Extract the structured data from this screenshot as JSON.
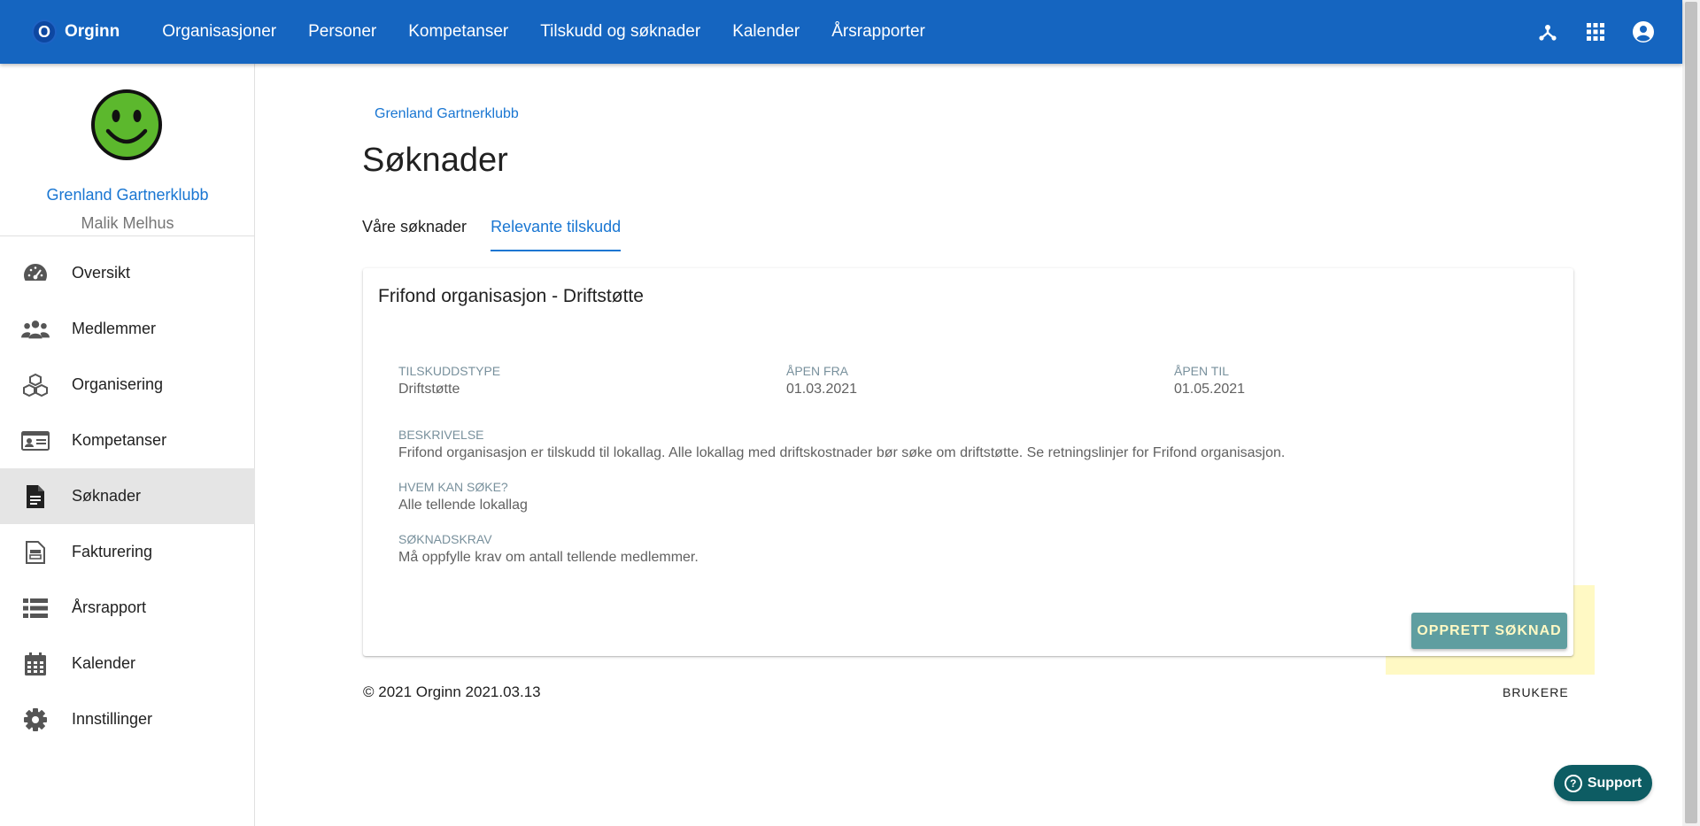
{
  "app": {
    "logo_letter": "O",
    "name": "Orginn"
  },
  "topnav": [
    {
      "label": "Organisasjoner"
    },
    {
      "label": "Personer"
    },
    {
      "label": "Kompetanser"
    },
    {
      "label": "Tilskudd og søknader"
    },
    {
      "label": "Kalender"
    },
    {
      "label": "Årsrapporter"
    }
  ],
  "top_icons": [
    "hub-icon",
    "apps-grid-icon",
    "account-circle-icon"
  ],
  "sidebar": {
    "avatar_icon": "smiley-face-icon",
    "org_name": "Grenland Gartnerklubb",
    "user_name": "Malik Melhus",
    "items": [
      {
        "label": "Oversikt",
        "icon": "speedometer-icon"
      },
      {
        "label": "Medlemmer",
        "icon": "people-icon"
      },
      {
        "label": "Organisering",
        "icon": "cubes-icon"
      },
      {
        "label": "Kompetanser",
        "icon": "id-card-icon"
      },
      {
        "label": "Søknader",
        "icon": "document-icon",
        "active": true
      },
      {
        "label": "Fakturering",
        "icon": "invoice-icon"
      },
      {
        "label": "Årsrapport",
        "icon": "list-icon"
      },
      {
        "label": "Kalender",
        "icon": "calendar-icon"
      },
      {
        "label": "Innstillinger",
        "icon": "gear-icon"
      }
    ]
  },
  "main": {
    "breadcrumb": "Grenland Gartnerklubb",
    "title": "Søknader",
    "tabs": [
      {
        "label": "Våre søknader"
      },
      {
        "label": "Relevante tilskudd",
        "active": true
      }
    ],
    "card": {
      "title": "Frifond organisasjon - Driftstøtte",
      "grant_type_label": "TILSKUDDSTYPE",
      "grant_type_value": "Driftstøtte",
      "open_from_label": "ÅPEN FRA",
      "open_from_value": "01.03.2021",
      "open_to_label": "ÅPEN TIL",
      "open_to_value": "01.05.2021",
      "description_label": "BESKRIVELSE",
      "description_value": "Frifond organisasjon er tilskudd til lokallag. Alle lokallag med driftskostnader bør søke om driftstøtte. Se retningslinjer for Frifond organisasjon.",
      "who_label": "HVEM KAN SØKE?",
      "who_value": "Alle tellende lokallag",
      "requirements_label": "SØKNADSKRAV",
      "requirements_value": "Må oppfylle krav om antall tellende medlemmer.",
      "create_button": "OPPRETT SØKNAD"
    }
  },
  "footer": {
    "copyright": "© 2021 Orginn 2021.03.13",
    "users_link": "BRUKERE"
  },
  "support": {
    "label": "Support",
    "icon_glyph": "?"
  },
  "colors": {
    "topbar": "#1565c0",
    "link": "#1976d2",
    "active_sidebar": "#e5e5e5",
    "highlight": "#fff9c4",
    "primary_button": "#5f9ea0",
    "support_button": "#0d5c63"
  }
}
